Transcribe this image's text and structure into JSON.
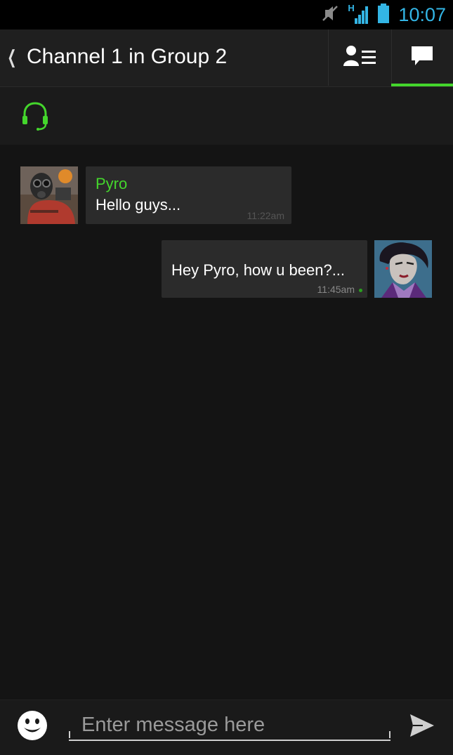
{
  "status_bar": {
    "time": "10:07",
    "network_label": "H",
    "icons": [
      "mute-icon",
      "signal-icon",
      "battery-icon"
    ]
  },
  "action_bar": {
    "back_icon": "chevron-left-icon",
    "title": "Channel 1 in Group 2",
    "members_icon": "member-list-icon",
    "chat_icon": "chat-bubble-icon",
    "active_tab": "chat"
  },
  "voice_bar": {
    "icon": "headset-icon"
  },
  "messages": [
    {
      "direction": "incoming",
      "sender": "Pyro",
      "text": "Hello guys...",
      "time": "11:22am",
      "avatar": "pyro-avatar"
    },
    {
      "direction": "outgoing",
      "text": "Hey Pyro, how u been?...",
      "time": "11:45am",
      "delivered": true,
      "avatar": "villainess-avatar"
    }
  ],
  "composer": {
    "placeholder": "Enter message here",
    "value": "",
    "emoji_icon": "smiley-icon",
    "send_icon": "send-icon"
  },
  "colors": {
    "accent": "#44d62c",
    "status_time": "#33b5e5",
    "background": "#141414",
    "bubble": "#2b2b2b"
  }
}
